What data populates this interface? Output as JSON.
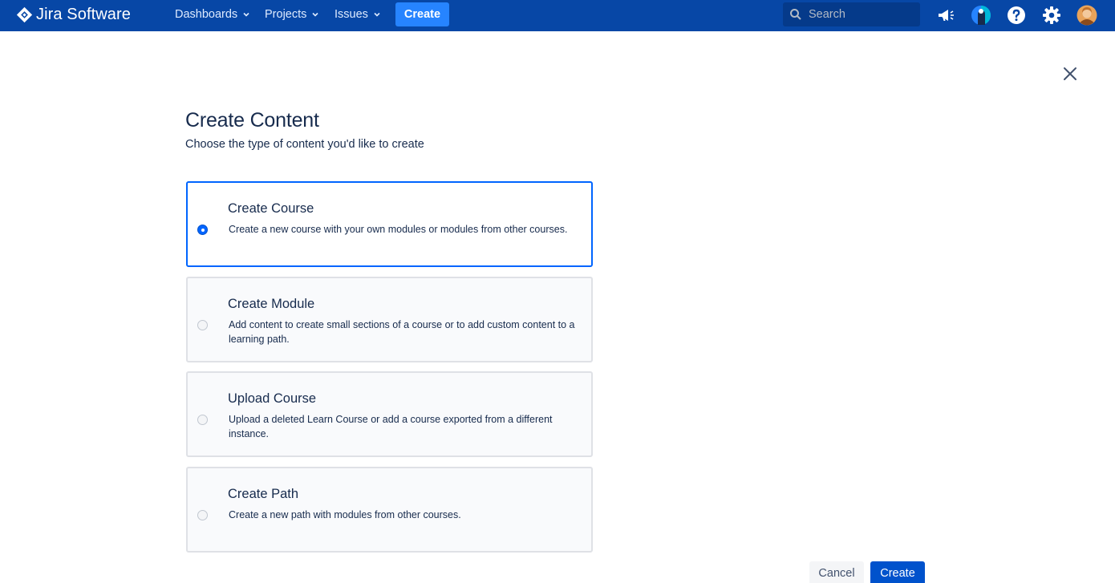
{
  "header": {
    "logo_text": "Jira Software",
    "nav": [
      {
        "label": "Dashboards",
        "icon": "chevron-down-icon"
      },
      {
        "label": "Projects",
        "icon": "chevron-down-icon"
      },
      {
        "label": "Issues",
        "icon": "chevron-down-icon"
      }
    ],
    "create_label": "Create",
    "search": {
      "placeholder": "Search",
      "value": ""
    },
    "icons": [
      "megaphone-icon",
      "app-switcher-icon",
      "help-icon",
      "settings-icon",
      "avatar"
    ]
  },
  "dialog": {
    "title": "Create Content",
    "subtitle": "Choose the type of content you'd like to create",
    "options": [
      {
        "title": "Create Course",
        "description": "Create a new course with your own modules or modules from other courses.",
        "selected": true
      },
      {
        "title": "Create Module",
        "description": "Add content to create small sections of a course or to add custom content to a learning path.",
        "selected": false
      },
      {
        "title": "Upload Course",
        "description": "Upload a deleted Learn Course or add a course exported from a different instance.",
        "selected": false
      },
      {
        "title": "Create Path",
        "description": "Create a new path with modules from other courses.",
        "selected": false
      }
    ],
    "cancel_label": "Cancel",
    "submit_label": "Create"
  },
  "colors": {
    "nav_background": "#0747a6",
    "accent": "#0065ff",
    "primary_button": "#0052cc"
  }
}
